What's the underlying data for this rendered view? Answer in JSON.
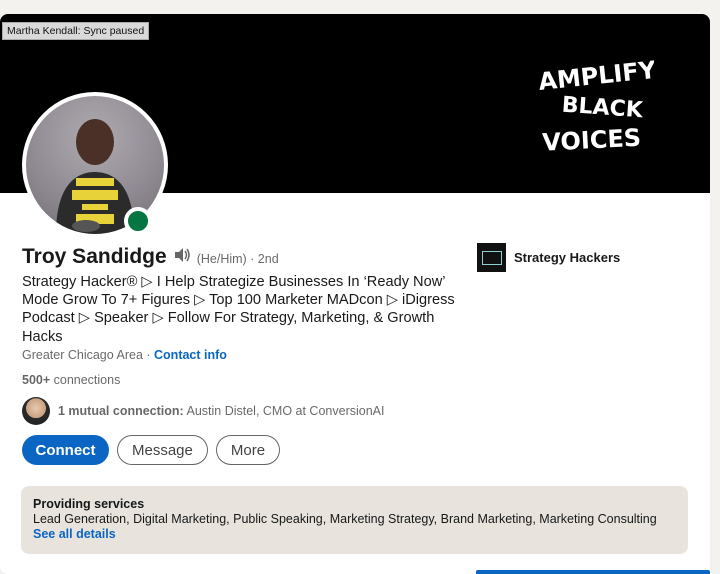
{
  "sync_status": "Martha Kendall: Sync paused",
  "banner": {
    "logo_icon": "amplify-black-voices-logo",
    "logo_text": "AMPLIFY BLACK VOICES"
  },
  "profile": {
    "name": "Troy Sandidge",
    "pronouns": "(He/Him) · 2nd",
    "headline": "Strategy Hacker® ▷ I Help Strategize Businesses In ‘Ready Now’ Mode Grow To 7+ Figures ▷ Top 100 Marketer MADcon ▷ iDigress Podcast ▷ Speaker ▷ Follow For Strategy, Marketing, & Growth Hacks",
    "location": "Greater Chicago Area",
    "location_separator": " · ",
    "contact_info": "Contact info",
    "connections_count": "500+",
    "connections_label": " connections",
    "mutual_label": "1 mutual connection:",
    "mutual_names": " Austin Distel, CMO at ConversionAI",
    "online_status_color": "#057642"
  },
  "actions": {
    "connect": "Connect",
    "message": "Message",
    "more": "More"
  },
  "company": {
    "name": "Strategy Hackers"
  },
  "services": {
    "title": "Providing services",
    "list": "Lead Generation, Digital Marketing, Public Speaking, Marketing Strategy, Brand Marketing, Marketing Consulting",
    "link": "See all details"
  },
  "colors": {
    "accent": "#0a66c2",
    "banner": "#000000",
    "services_bg": "#e8e4dd"
  }
}
